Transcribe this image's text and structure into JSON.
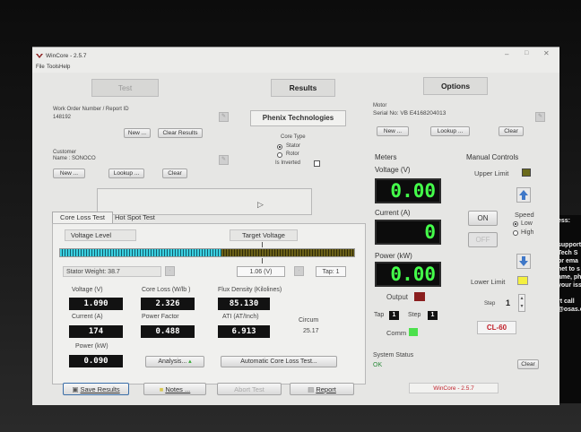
{
  "app": {
    "title": "WinCore - 2.5.7",
    "menu": [
      "File",
      "Tools",
      "Help"
    ],
    "status_footer": "WinCore - 2.5.7"
  },
  "nav": {
    "test": "Test",
    "results": "Results",
    "options": "Options"
  },
  "work_order": {
    "label": "Work Order Number / Report ID",
    "value": "148192",
    "new": "New ...",
    "clear": "Clear Results"
  },
  "customer": {
    "label": "Customer",
    "name": "Name : SONOCO",
    "new": "New ...",
    "lookup": "Lookup ...",
    "clear": "Clear"
  },
  "company": "Phenix Technologies",
  "core_type": {
    "label": "Core Type",
    "options": [
      "Stator",
      "Rotor"
    ],
    "selected": "Stator",
    "inverted_label": "Is Inverted"
  },
  "motor": {
    "label": "Motor",
    "serial": "Serial No: VB E4168204013",
    "new": "New ...",
    "lookup": "Lookup ...",
    "clear": "Clear"
  },
  "meters": {
    "title": "Meters",
    "voltage_label": "Voltage (V)",
    "voltage": "0.00",
    "current_label": "Current (A)",
    "current": "0",
    "power_label": "Power (kW)",
    "power": "0.00",
    "output_label": "Output",
    "tap_label": "Tap",
    "tap": "1",
    "step_label": "Step",
    "step": "1",
    "comm_label": "Comm"
  },
  "manual": {
    "title": "Manual Controls",
    "upper_limit": "Upper Limit",
    "on": "ON",
    "off": "OFF",
    "speed": "Speed",
    "low": "Low",
    "high": "High",
    "speed_selected": "Low",
    "lower_limit": "Lower Limit",
    "step_label": "Step",
    "step": "1",
    "model": "CL-60",
    "clear": "Clear"
  },
  "tabs": [
    "Core Loss Test",
    "Hot Spot Test"
  ],
  "coreloss": {
    "voltage_level": "Voltage Level",
    "target_voltage": "Target Voltage",
    "level_fraction": 0.55,
    "stator_weight": "Stator Weight: 38.7",
    "target_value": "1.06 (V)",
    "tap": "Tap: 1",
    "voltage_label": "Voltage (V)",
    "voltage": "1.090",
    "core_loss_label": "Core Loss (W/lb )",
    "core_loss": "2.326",
    "flux_label": "Flux Density (Kilolines)",
    "flux": "85.130",
    "current_label": "Current (A)",
    "current": "174",
    "pf_label": "Power Factor",
    "pf": "0.488",
    "ati_label": "ATI (AT/Inch)",
    "ati": "6.913",
    "circum_label": "Circum",
    "circum": "25.17",
    "power_label": "Power (kW)",
    "power": "0.090",
    "analysis": "Analysis...",
    "auto": "Automatic Core Loss Test..."
  },
  "bottom": {
    "save": "Save Results",
    "notes": "Notes ...",
    "abort": "Abort Test",
    "report": "Report"
  },
  "system_status": {
    "label": "System Status",
    "value": "OK"
  },
  "behind_text": [
    "ess:",
    "",
    "",
    "support",
    "Tech S",
    "or ema",
    "net to s",
    "ame, ph",
    "your iss",
    "",
    "rt call",
    "@osas.c"
  ],
  "colors": {
    "lcd_green": "#44ff4a",
    "output_red": "#8a1e1e",
    "comm_green": "#4ce04c",
    "limit_olive": "#6a6a1a",
    "limit_yellow": "#f4f040",
    "model_red": "#c0202a",
    "arrow_blue": "#3f78c8"
  }
}
